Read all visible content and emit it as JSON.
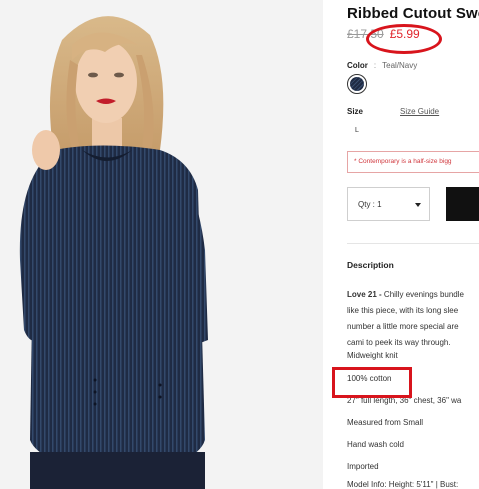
{
  "product": {
    "title": "Ribbed Cutout Swe",
    "old_price": "£17.50",
    "new_price": "£5.99",
    "color_label": "Color",
    "color_sep": ":",
    "color_value": "Teal/Navy",
    "size_label": "Size",
    "size_guide": "Size Guide",
    "size_options": [
      "L"
    ],
    "notice": "* Contemporary is a half-size bigg",
    "qty_label": "Qty : 1"
  },
  "description": {
    "heading": "Description",
    "brand": "Love 21 -",
    "lines": [
      "Chilly evenings bundle",
      "like this piece, with its long slee",
      "number a little more special are",
      "cami to peek its way through."
    ],
    "specs": [
      "Midweight knit",
      "100% cotton",
      "27\" full length, 36\" chest, 36\" wa",
      "Measured from Small",
      "Hand wash cold",
      "Imported",
      "Model Info: Height: 5'11\" | Bust:"
    ]
  },
  "colors": {
    "price_red": "#e0262d",
    "annotation_red": "#d8141c",
    "sweater_navy": "#1f2b44"
  }
}
